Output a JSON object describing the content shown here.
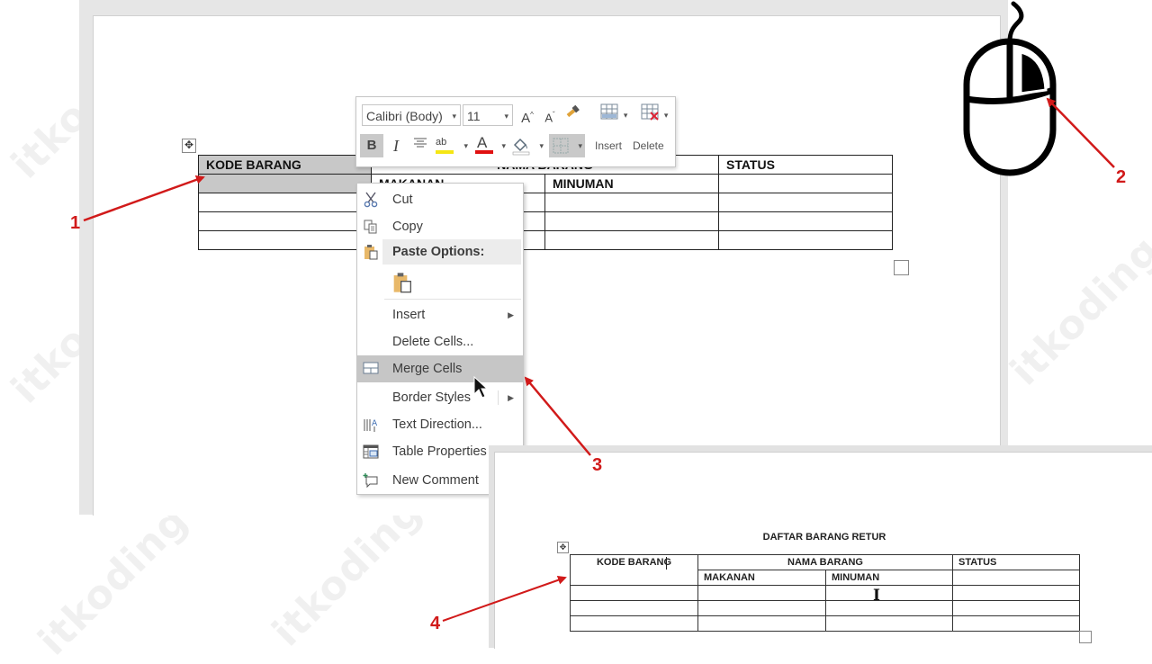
{
  "watermark": "itkoding",
  "step1": {
    "table": {
      "header_row1": [
        "KODE BARANG",
        "NAMA BARANG",
        "STATUS"
      ],
      "header_row2": [
        "",
        "MAKANAN",
        "MINUMAN",
        ""
      ],
      "empty_rows": 3
    }
  },
  "mini_toolbar": {
    "font_name": "Calibri (Body)",
    "font_size": "11",
    "grow_font": "A",
    "shrink_font": "A",
    "bold": "B",
    "italic": "I",
    "highlight_label": "ab",
    "font_color_label": "A",
    "insert_label": "Insert",
    "delete_label": "Delete",
    "highlight_color": "#f5e614",
    "font_color": "#e01010"
  },
  "context_menu": {
    "items": [
      {
        "label": "Cut",
        "icon": "scissors-icon"
      },
      {
        "label": "Copy",
        "icon": "copy-icon"
      },
      {
        "label": "Paste Options:",
        "icon": "paste-icon",
        "header": true
      },
      {
        "label": "",
        "icon": "paste-keep-source-icon"
      },
      {
        "label": "Insert",
        "submenu": true
      },
      {
        "label": "Delete Cells..."
      },
      {
        "label": "Merge Cells",
        "icon": "merge-cells-icon",
        "highlighted": true
      },
      {
        "label": "Border Styles",
        "submenu": true
      },
      {
        "label": "Text Direction...",
        "icon": "text-direction-icon"
      },
      {
        "label": "Table Properties",
        "icon": "table-properties-icon"
      },
      {
        "label": "New Comment",
        "icon": "new-comment-icon"
      }
    ]
  },
  "annotations": {
    "labels": [
      "1",
      "2",
      "3",
      "4"
    ],
    "color": "#d11a1a"
  },
  "step4": {
    "title": "DAFTAR BARANG RETUR",
    "table": {
      "header_row1": [
        "KODE BARANG",
        "NAMA BARANG",
        "STATUS"
      ],
      "header_row2": [
        "MAKANAN",
        "MINUMAN",
        ""
      ],
      "empty_rows": 3
    }
  }
}
